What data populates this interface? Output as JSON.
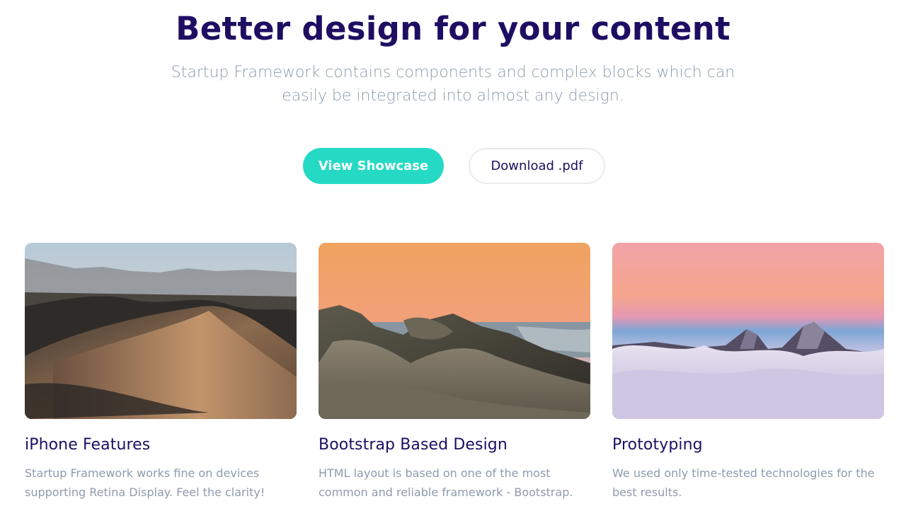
{
  "hero": {
    "title": "Better design for your content",
    "subtitle": "Startup Framework contains components and complex blocks which can easily be integrated into almost any design.",
    "primary_button": "View Showcase",
    "secondary_button": "Download .pdf"
  },
  "colors": {
    "heading": "#1e0e62",
    "muted": "#8f9bad",
    "accent": "#25dac5"
  },
  "cards": [
    {
      "image": "desert-dunes-photo",
      "title": "iPhone Features",
      "text": "Startup Framework works fine on devices supporting Retina Display. Feel the clarity!"
    },
    {
      "image": "coastal-rocks-sunset-photo",
      "title": "Bootstrap Based Design",
      "text": "HTML layout is based on one of the most common and reliable framework - Bootstrap."
    },
    {
      "image": "mountain-peaks-clouds-photo",
      "title": "Prototyping",
      "text": "We used only time-tested technologies for the best results."
    }
  ]
}
